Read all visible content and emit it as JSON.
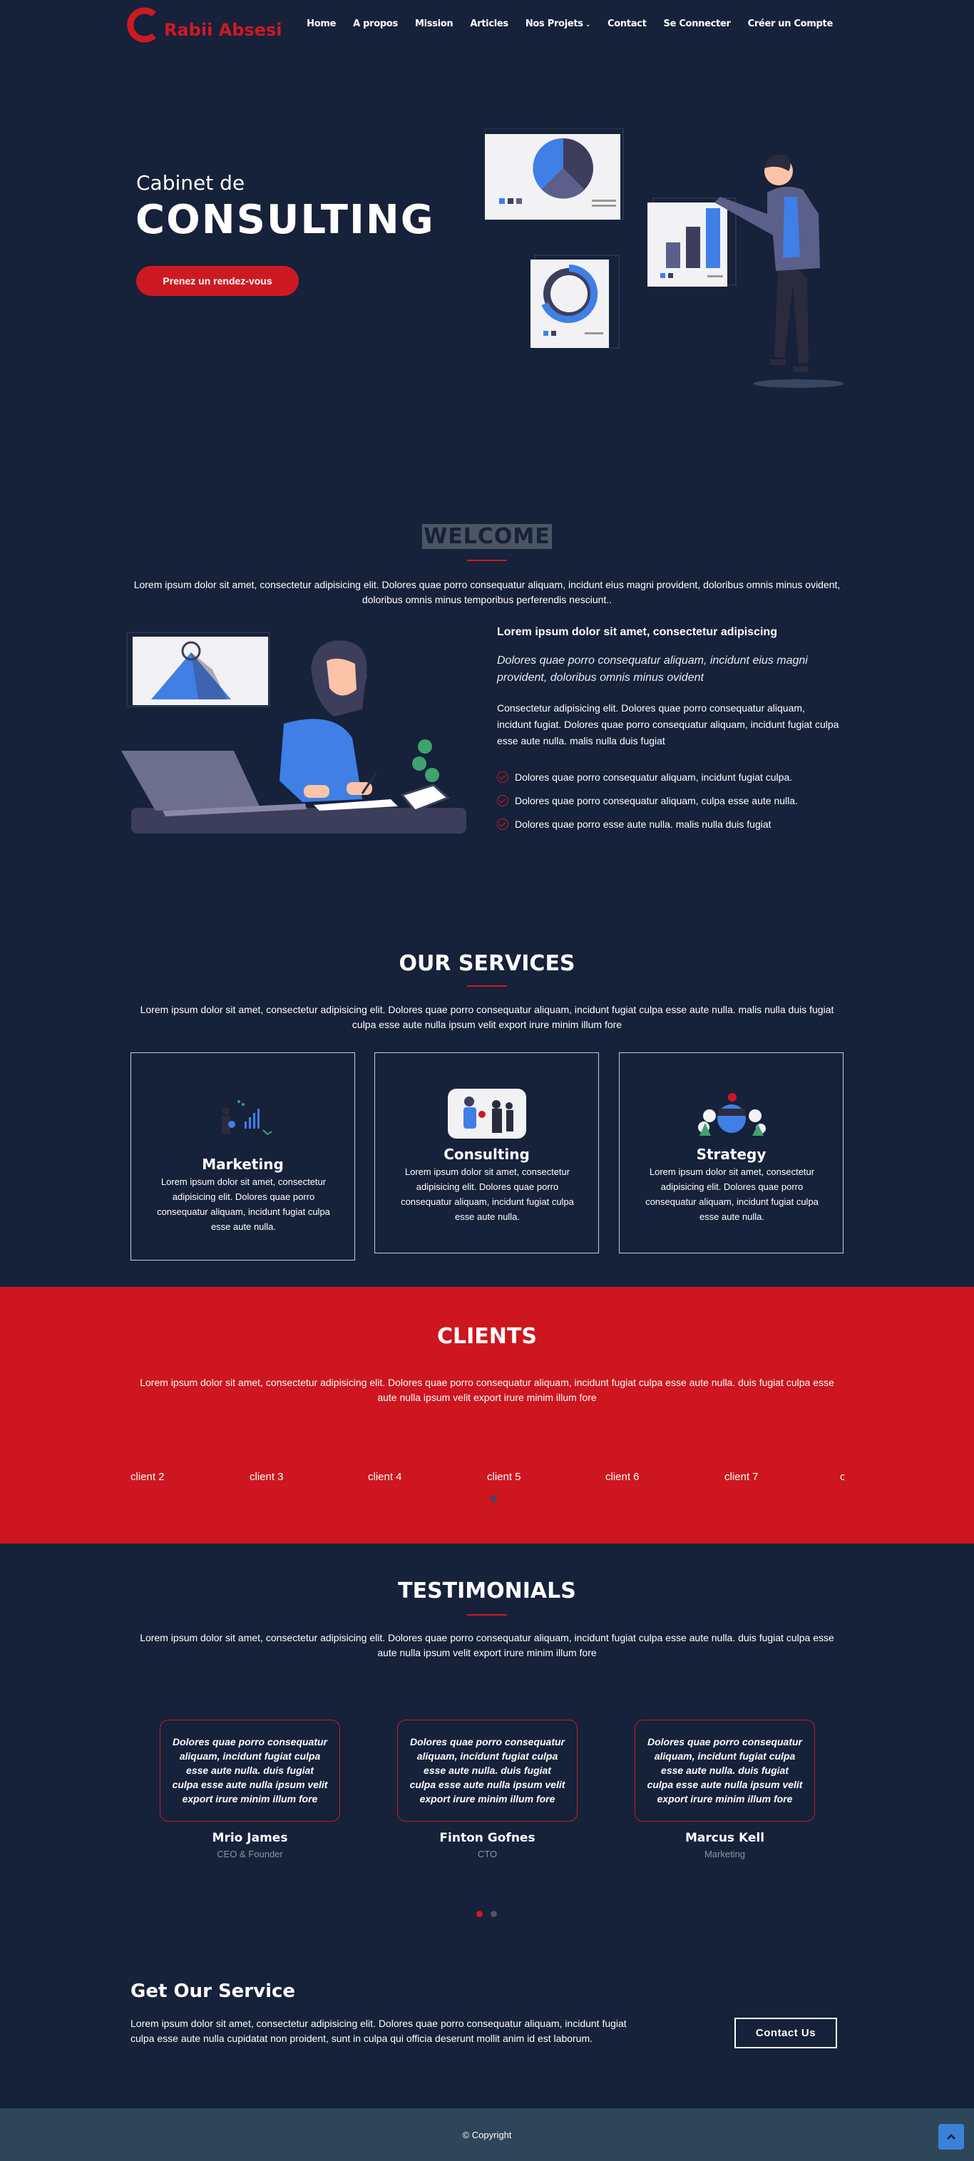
{
  "brand": {
    "name": "Rabii Absesi",
    "color": "#cd1a22"
  },
  "nav": {
    "items": [
      {
        "label": "Home"
      },
      {
        "label": "A propos"
      },
      {
        "label": "Mission"
      },
      {
        "label": "Articles"
      },
      {
        "label": "Nos Projets",
        "dropdown": true
      },
      {
        "label": "Contact"
      },
      {
        "label": "Se Connecter"
      },
      {
        "label": "Créer un Compte"
      }
    ]
  },
  "hero": {
    "subtitle": "Cabinet de",
    "title": "CONSULTING",
    "button": "Prenez un rendez-vous"
  },
  "welcome": {
    "title": "WELCOME",
    "intro": "Lorem ipsum dolor sit amet, consectetur adipisicing elit. Dolores quae porro consequatur aliquam, incidunt eius magni provident, doloribus omnis minus ovident, doloribus omnis minus temporibus perferendis nesciunt..",
    "heading": "Lorem ipsum dolor sit amet, consectetur adipiscing",
    "italic": "Dolores quae porro consequatur aliquam, incidunt eius magni provident, doloribus omnis minus ovident",
    "paragraph": "Consectetur adipisicing elit. Dolores quae porro consequatur aliquam, incidunt fugiat. Dolores quae porro consequatur aliquam, incidunt fugiat culpa esse aute nulla. malis nulla duis fugiat",
    "list": [
      "Dolores quae porro consequatur aliquam, incidunt fugiat culpa.",
      "Dolores quae porro consequatur aliquam, culpa esse aute nulla.",
      "Dolores quae porro esse aute nulla. malis nulla duis fugiat"
    ]
  },
  "services": {
    "title": "OUR SERVICES",
    "intro": "Lorem ipsum dolor sit amet, consectetur adipisicing elit. Dolores quae porro consequatur aliquam, incidunt fugiat culpa esse aute nulla. malis nulla duis fugiat culpa esse aute nulla ipsum velit export irure minim illum fore",
    "cards": [
      {
        "name": "Marketing",
        "desc": "Lorem ipsum dolor sit amet, consectetur adipisicing elit. Dolores quae porro consequatur aliquam, incidunt fugiat culpa esse aute nulla."
      },
      {
        "name": "Consulting",
        "desc": "Lorem ipsum dolor sit amet, consectetur adipisicing elit. Dolores quae porro consequatur aliquam, incidunt fugiat culpa esse aute nulla."
      },
      {
        "name": "Strategy",
        "desc": "Lorem ipsum dolor sit amet, consectetur adipisicing elit. Dolores quae porro consequatur aliquam, incidunt fugiat culpa esse aute nulla."
      }
    ]
  },
  "clients": {
    "title": "CLIENTS",
    "intro": "Lorem ipsum dolor sit amet, consectetur adipisicing elit. Dolores quae porro consequatur aliquam, incidunt fugiat culpa esse aute nulla. duis fugiat culpa esse aute nulla ipsum velit export irure minim illum fore",
    "logos": [
      "client 2",
      "client 3",
      "client 4",
      "client 5",
      "client 6",
      "client 7",
      "c"
    ]
  },
  "testimonials": {
    "title": "TESTIMONIALS",
    "intro": "Lorem ipsum dolor sit amet, consectetur adipisicing elit. Dolores quae porro consequatur aliquam, incidunt fugiat culpa esse aute nulla. duis fugiat culpa esse aute nulla ipsum velit export irure minim illum fore",
    "items": [
      {
        "quote": "Dolores quae porro consequatur aliquam, incidunt fugiat culpa esse aute nulla. duis fugiat culpa esse aute nulla ipsum velit export irure minim illum fore",
        "name": "Mrio James",
        "role": "CEO & Founder"
      },
      {
        "quote": "Dolores quae porro consequatur aliquam, incidunt fugiat culpa esse aute nulla. duis fugiat culpa esse aute nulla ipsum velit export irure minim illum fore",
        "name": "Finton Gofnes",
        "role": "CTO"
      },
      {
        "quote": "Dolores quae porro consequatur aliquam, incidunt fugiat culpa esse aute nulla. duis fugiat culpa esse aute nulla ipsum velit export irure minim illum fore",
        "name": "Marcus Kell",
        "role": "Marketing"
      }
    ]
  },
  "cta": {
    "title": "Get Our Service",
    "text": "Lorem ipsum dolor sit amet, consectetur adipisicing elit. Dolores quae porro consequatur aliquam, incidunt fugiat culpa esse aute nulla cupidatat non proident, sunt in culpa qui officia deserunt mollit anim id est laborum.",
    "button": "Contact Us"
  },
  "footer": {
    "copyright": "© Copyright"
  },
  "colors": {
    "background": "#16213a",
    "accent": "#cd1a22",
    "footer": "#2d4659",
    "illustration": "#3f7fe6"
  }
}
